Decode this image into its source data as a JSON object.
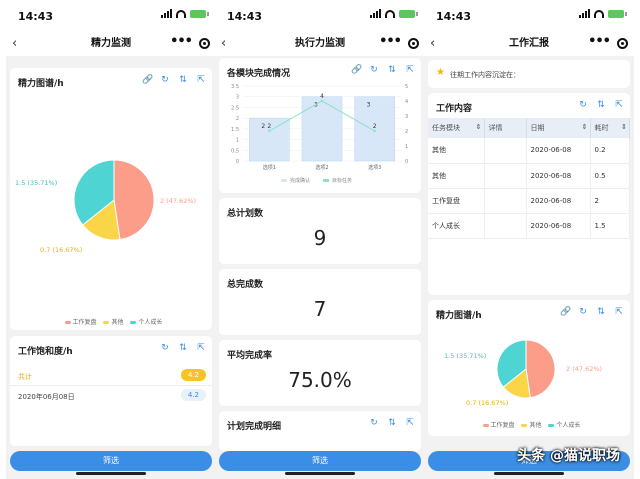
{
  "time": "14:43",
  "filter_label": "筛选",
  "phone1": {
    "title": "精力监测",
    "pie_card": {
      "title": "精力图谱/h",
      "labels": [
        "2 (47.62%)",
        "0.7 (16.67%)",
        "1.5 (35.71%)"
      ],
      "legend": [
        "工作复盘",
        "其他",
        "个人成长"
      ]
    },
    "sat_card": {
      "title": "工作饱和度/h",
      "rows": [
        {
          "label": "共计",
          "value": "4.2"
        },
        {
          "label": "2020年06月08日",
          "value": "4.2"
        }
      ]
    }
  },
  "phone2": {
    "title": "执行力监测",
    "chart_card": {
      "title": "各模块完成情况"
    },
    "total_plan": {
      "label": "总计划数",
      "value": "9"
    },
    "total_done": {
      "label": "总完成数",
      "value": "7"
    },
    "avg_rate": {
      "label": "平均完成率",
      "value": "75.0%"
    },
    "detail": {
      "title": "计划完成明细"
    }
  },
  "phone3": {
    "title": "工作汇报",
    "notice": "往期工作内容沉淀在：",
    "work_card": {
      "title": "工作内容",
      "headers": [
        "任务模块",
        "详情",
        "日期",
        "耗时"
      ],
      "rows": [
        [
          "其他",
          "",
          "2020-06-08",
          "0.2"
        ],
        [
          "其他",
          "",
          "2020-06-08",
          "0.5"
        ],
        [
          "工作复盘",
          "",
          "2020-06-08",
          "2"
        ],
        [
          "个人成长",
          "",
          "2020-06-08",
          "1.5"
        ]
      ]
    },
    "pie_card": {
      "title": "精力图谱/h",
      "labels": [
        "2 (47.62%)",
        "0.7 (16.67%)",
        "1.5 (35.71%)"
      ],
      "legend": [
        "工作复盘",
        "其他",
        "个人成长"
      ]
    }
  },
  "watermark": "头条 @猫说职场",
  "colors": {
    "accent": "#3a8ee6",
    "red": "#fc9d8a",
    "yellow": "#f9d547",
    "teal": "#4fd4d4",
    "badge": "#f7c425"
  },
  "chart_data": [
    {
      "type": "pie",
      "values": [
        2,
        0.7,
        1.5
      ],
      "labels": [
        "工作复盘",
        "其他",
        "个人成长"
      ],
      "slice_labels": [
        "2 (47.62%)",
        "0.7 (16.67%)",
        "1.5 (35.71%)"
      ]
    },
    {
      "type": "bar",
      "categories": [
        "选项1",
        "选项2",
        "选项3"
      ],
      "series": [
        {
          "name": "完成确认",
          "values": [
            2,
            3,
            3
          ],
          "kind": "bar"
        },
        {
          "name": "目标任务",
          "values": [
            2,
            4,
            2
          ],
          "kind": "line"
        }
      ],
      "ylim_left": [
        0,
        3.5
      ],
      "ylim_right": [
        0,
        5
      ],
      "yticks_left": [
        "0",
        "0.5",
        "1",
        "1.5",
        "2",
        "2.5",
        "3",
        "3.5"
      ],
      "yticks_right": [
        "0",
        "1",
        "2",
        "3",
        "4",
        "5"
      ],
      "legend": "bottom"
    },
    {
      "type": "pie",
      "values": [
        2,
        0.7,
        1.5
      ],
      "labels": [
        "工作复盘",
        "其他",
        "个人成长"
      ],
      "slice_labels": [
        "2 (47.62%)",
        "0.7 (16.67%)",
        "1.5 (35.71%)"
      ]
    }
  ]
}
